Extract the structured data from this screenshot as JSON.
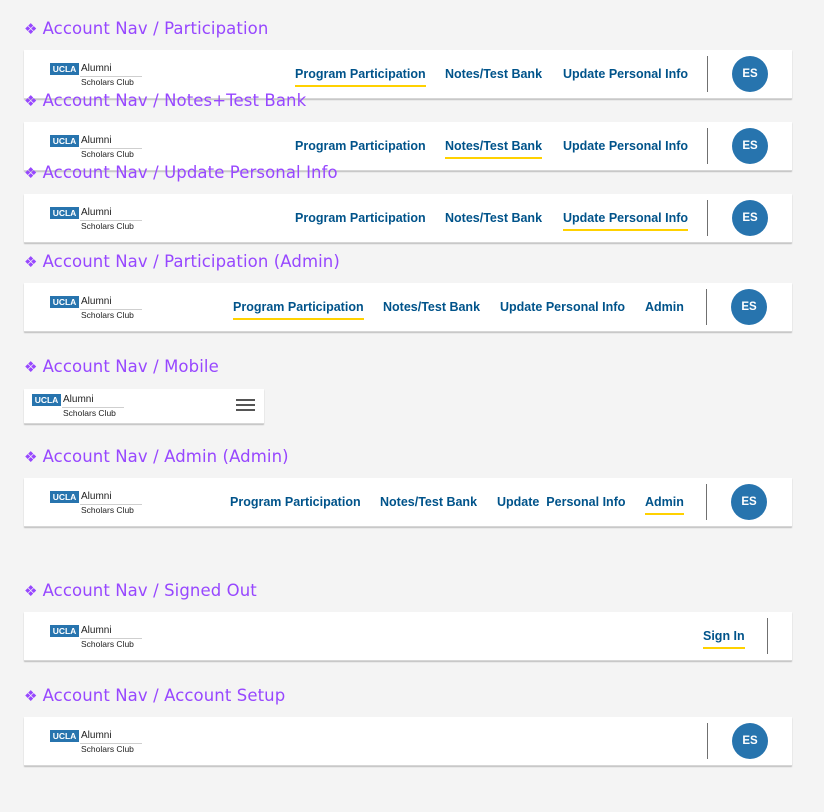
{
  "logo": {
    "badge": "UCLA",
    "line1": "Alumni",
    "line2": "Scholars Club"
  },
  "frames": [
    {
      "title": "Account Nav / Participation",
      "links": [
        "Program Participation",
        "Notes/Test Bank",
        "Update Personal Info"
      ],
      "avatar": "ES"
    },
    {
      "title": "Account Nav / Notes+Test Bank",
      "links": [
        "Program Participation",
        "Notes/Test Bank",
        "Update Personal Info"
      ],
      "avatar": "ES"
    },
    {
      "title": "Account Nav / Update Personal Info",
      "links": [
        "Program Participation",
        "Notes/Test Bank",
        "Update Personal Info"
      ],
      "avatar": "ES"
    },
    {
      "title": "Account Nav / Participation (Admin)",
      "links": [
        "Program Participation",
        "Notes/Test Bank",
        "Update Personal Info",
        "Admin"
      ],
      "avatar": "ES"
    },
    {
      "title": "Account Nav / Mobile"
    },
    {
      "title": "Account Nav / Admin (Admin)",
      "links": [
        "Program Participation",
        "Notes/Test Bank",
        "Update  Personal Info",
        "Admin"
      ],
      "avatar": "ES"
    },
    {
      "title": "Account Nav / Signed Out",
      "sign_in": "Sign In"
    },
    {
      "title": "Account Nav / Account Setup",
      "avatar": "ES"
    }
  ],
  "colors": {
    "title": "#9747ff",
    "link": "#00538a",
    "underline": "#ffd100",
    "avatar": "#2774ae"
  },
  "icons": {
    "title_marker": "component-diamond-icon",
    "menu": "hamburger-menu-icon"
  }
}
